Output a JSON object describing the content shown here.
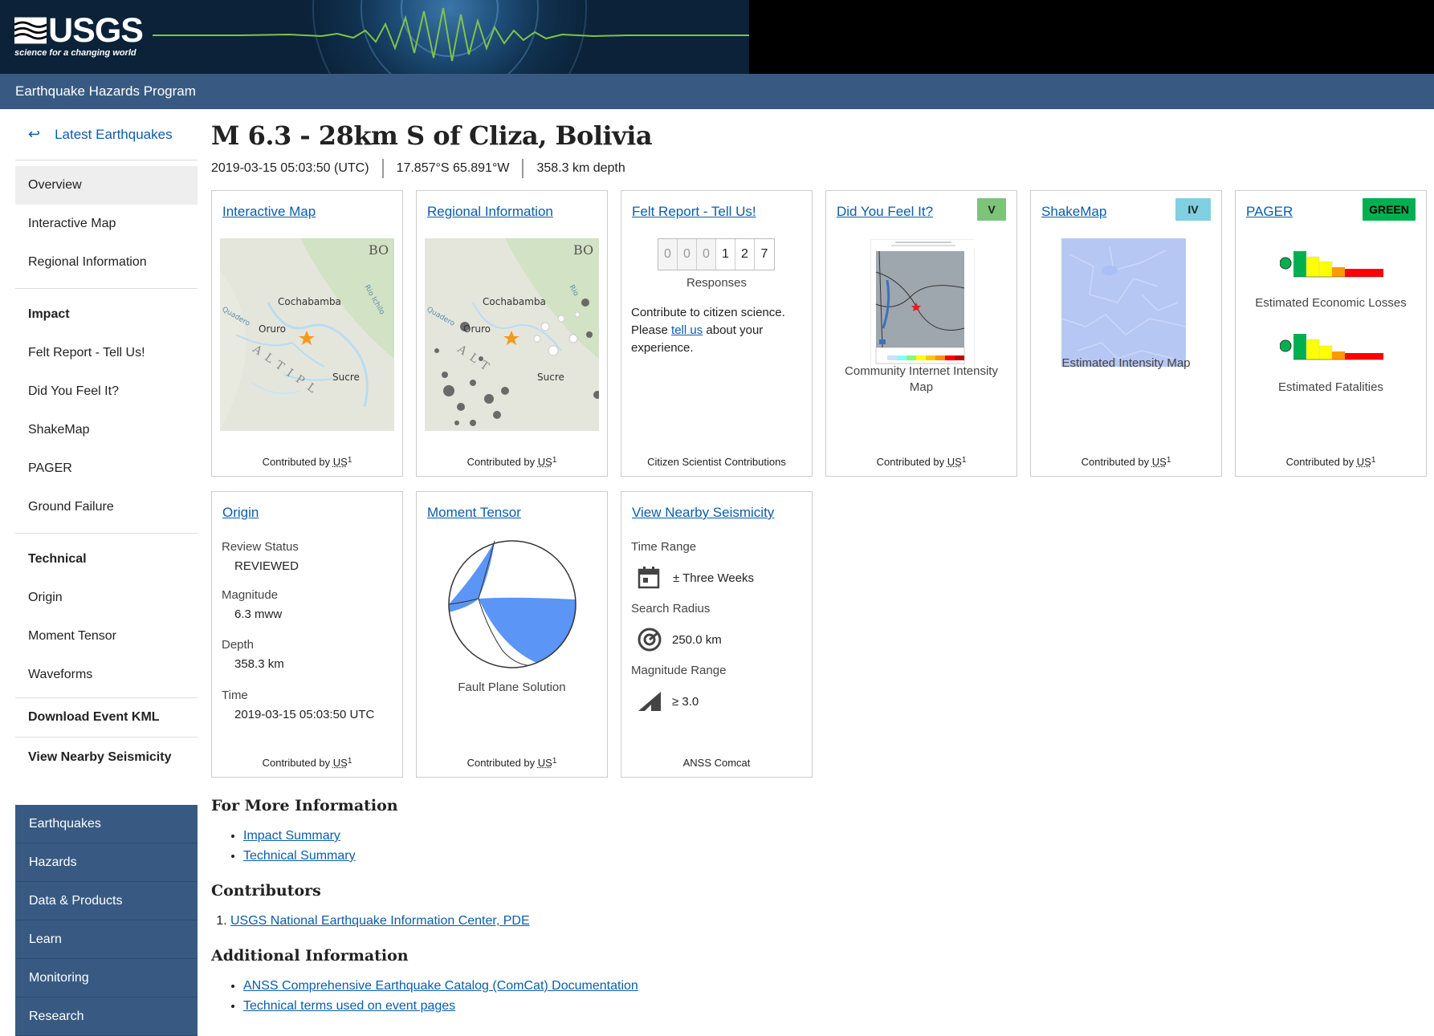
{
  "header": {
    "logo_text": "USGS",
    "logo_tagline": "science for a changing world",
    "program": "Earthquake Hazards Program"
  },
  "sidebar": {
    "back_label": "Latest Earthquakes",
    "items": [
      {
        "label": "Overview",
        "active": true
      },
      {
        "label": "Interactive Map"
      },
      {
        "label": "Regional Information"
      }
    ],
    "impact_head": "Impact",
    "impact_items": [
      "Felt Report - Tell Us!",
      "Did You Feel It?",
      "ShakeMap",
      "PAGER",
      "Ground Failure"
    ],
    "technical_head": "Technical",
    "technical_items": [
      "Origin",
      "Moment Tensor",
      "Waveforms"
    ],
    "download_kml": "Download Event KML",
    "nearby": "View Nearby Seismicity"
  },
  "nav": [
    "Earthquakes",
    "Hazards",
    "Data & Products",
    "Learn",
    "Monitoring",
    "Research"
  ],
  "event": {
    "title": "M 6.3 - 28km S of Cliza, Bolivia",
    "time": "2019-03-15 05:03:50 (UTC)",
    "location": "17.857°S 65.891°W",
    "depth": "358.3 km depth"
  },
  "cards": {
    "interactive_map": {
      "title": "Interactive Map",
      "foot": "Contributed by",
      "src": "US",
      "sup": "1",
      "map_labels": [
        "BO",
        "Cochabamba",
        "Oruro",
        "Sucre",
        "Rio Ichilo",
        "Quadero",
        "ALTIPL"
      ]
    },
    "regional": {
      "title": "Regional Information",
      "foot": "Contributed by",
      "src": "US",
      "sup": "1",
      "map_labels": [
        "BO",
        "Cochabamba",
        "Oruro",
        "Sucre",
        "Rio",
        "Quadero",
        "ALT"
      ]
    },
    "felt": {
      "title": "Felt Report - Tell Us!",
      "digits": [
        "0",
        "0",
        "0",
        "1",
        "2",
        "7"
      ],
      "responses": "Responses",
      "text_1": "Contribute to citizen science. Please ",
      "link": "tell us",
      "text_2": " about your experience.",
      "foot": "Citizen Scientist Contributions"
    },
    "dyfi": {
      "title": "Did You Feel It?",
      "badge": "V",
      "badge_color": "#7cc47a",
      "caption": "Community Internet Intensity Map",
      "foot": "Contributed by",
      "src": "US",
      "sup": "1"
    },
    "shakemap": {
      "title": "ShakeMap",
      "badge": "IV",
      "badge_color": "#7fd0e0",
      "caption": "Estimated Intensity Map",
      "foot": "Contributed by",
      "src": "US",
      "sup": "1"
    },
    "pager": {
      "title": "PAGER",
      "badge": "GREEN",
      "badge_color": "#00b050",
      "caption_1": "Estimated Economic Losses",
      "caption_2": "Estimated Fatalities",
      "foot": "Contributed by",
      "src": "US",
      "sup": "1"
    },
    "origin": {
      "title": "Origin",
      "fields": [
        {
          "label": "Review Status",
          "value": "REVIEWED"
        },
        {
          "label": "Magnitude",
          "value": "6.3 mww"
        },
        {
          "label": "Depth",
          "value": "358.3 km"
        },
        {
          "label": "Time",
          "value": "2019-03-15 05:03:50 UTC"
        }
      ],
      "foot": "Contributed by",
      "src": "US",
      "sup": "1"
    },
    "moment": {
      "title": "Moment Tensor",
      "caption": "Fault Plane Solution",
      "foot": "Contributed by",
      "src": "US",
      "sup": "1"
    },
    "nearby": {
      "title": "View Nearby Seismicity",
      "time_label": "Time Range",
      "time_value": "± Three Weeks",
      "radius_label": "Search Radius",
      "radius_value": "250.0 km",
      "mag_label": "Magnitude Range",
      "mag_value": "≥ 3.0",
      "foot": "ANSS Comcat"
    }
  },
  "more_info": {
    "heading": "For More Information",
    "links": [
      "Impact Summary",
      "Technical Summary"
    ]
  },
  "contributors": {
    "heading": "Contributors",
    "items": [
      "USGS National Earthquake Information Center, PDE"
    ]
  },
  "additional": {
    "heading": "Additional Information",
    "links": [
      "ANSS Comprehensive Earthquake Catalog (ComCat) Documentation",
      "Technical terms used on event pages"
    ]
  }
}
